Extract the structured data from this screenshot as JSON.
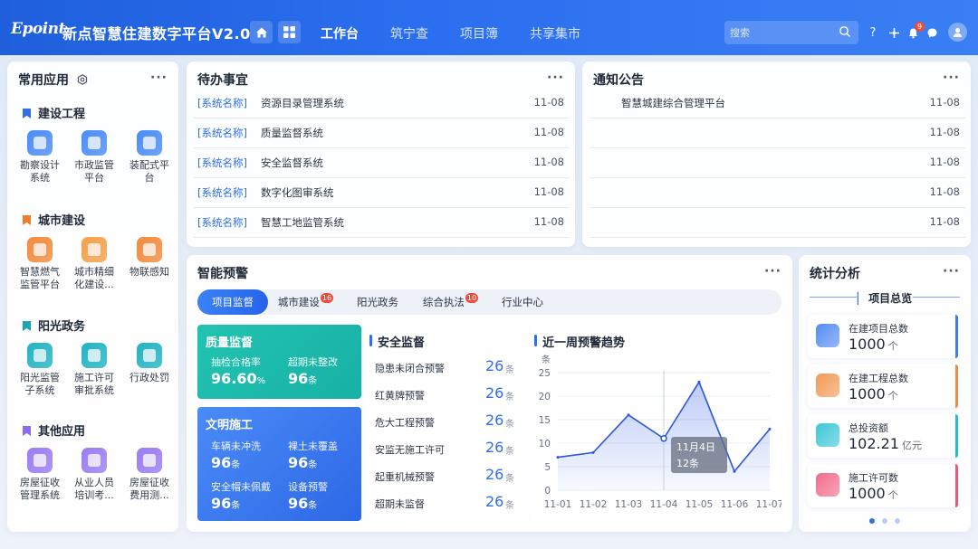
{
  "header": {
    "logo": "Epoint",
    "title": "新点智慧住建数字平台V2.0",
    "nav": [
      "工作台",
      "筑宁查",
      "项目簿",
      "共享集市"
    ],
    "search_placeholder": "搜索",
    "notification_count": "9"
  },
  "apps": {
    "title": "常用应用",
    "groups": [
      {
        "name": "建设工程",
        "color": "#2e6ee6",
        "items": [
          {
            "line1": "勘察设计",
            "line2": "系统",
            "icon": "survey-design-icon",
            "color": "#4a8cf7"
          },
          {
            "line1": "市政监管",
            "line2": "平台",
            "icon": "star-shield-icon",
            "color": "#4a8cf7"
          },
          {
            "line1": "装配式平",
            "line2": "台",
            "icon": "bookmark-icon",
            "color": "#4a8cf7"
          }
        ]
      },
      {
        "name": "城市建设",
        "color": "#f07d2e",
        "items": [
          {
            "line1": "智慧燃气",
            "line2": "监管平台",
            "icon": "flame-icon",
            "color": "#f38a3c"
          },
          {
            "line1": "城市精细",
            "line2": "化建设...",
            "icon": "building-icon",
            "color": "#f3a04a"
          },
          {
            "line1": "物联感知",
            "line2": "",
            "icon": "cube-icon",
            "color": "#f38a3c"
          }
        ]
      },
      {
        "name": "阳光政务",
        "color": "#18a6b8",
        "items": [
          {
            "line1": "阳光监管",
            "line2": "子系统",
            "icon": "shield-icon",
            "color": "#22b3c4"
          },
          {
            "line1": "施工许可",
            "line2": "审批系统",
            "icon": "monitor-icon",
            "color": "#22b3c4"
          },
          {
            "line1": "行政处罚",
            "line2": "",
            "icon": "penalty-shield-icon",
            "color": "#22b3c4"
          }
        ]
      },
      {
        "name": "其他应用",
        "color": "#8b6cf0",
        "items": [
          {
            "line1": "房屋征收",
            "line2": "管理系统",
            "icon": "house-icon",
            "color": "#9a7cf3"
          },
          {
            "line1": "从业人员",
            "line2": "培训考...",
            "icon": "briefcase-icon",
            "color": "#9a7cf3"
          },
          {
            "line1": "房屋征收",
            "line2": "费用测...",
            "icon": "document-icon",
            "color": "#9a7cf3"
          }
        ]
      }
    ]
  },
  "todo": {
    "title": "待办事宜",
    "items": [
      {
        "tag": "[系统名称]",
        "name": "资源目录管理系统",
        "date": "11-08"
      },
      {
        "tag": "[系统名称]",
        "name": "质量监督系统",
        "date": "11-08"
      },
      {
        "tag": "[系统名称]",
        "name": "安全监督系统",
        "date": "11-08"
      },
      {
        "tag": "[系统名称]",
        "name": "数字化图审系统",
        "date": "11-08"
      },
      {
        "tag": "[系统名称]",
        "name": "智慧工地监管系统",
        "date": "11-08"
      }
    ]
  },
  "notice": {
    "title": "通知公告",
    "items": [
      {
        "name": "智慧城建综合管理平台",
        "date": "11-08"
      },
      {
        "name": "",
        "date": "11-08"
      },
      {
        "name": "",
        "date": "11-08"
      },
      {
        "name": "",
        "date": "11-08"
      },
      {
        "name": "",
        "date": "11-08"
      }
    ]
  },
  "warning": {
    "title": "智能预警",
    "tabs": [
      {
        "label": "项目监督",
        "badge": ""
      },
      {
        "label": "城市建设",
        "badge": "16"
      },
      {
        "label": "阳光政务",
        "badge": ""
      },
      {
        "label": "综合执法",
        "badge": "10"
      },
      {
        "label": "行业中心",
        "badge": ""
      }
    ],
    "quality": {
      "title": "质量监督",
      "k1": "抽检合格率",
      "v1": "96.60",
      "u1": "%",
      "k2": "超期未整改",
      "v2": "96",
      "u2": "条",
      "color": "#1fbfae"
    },
    "civil": {
      "title": "文明施工",
      "k1": "车辆未冲洗",
      "v1": "96",
      "u1": "条",
      "k2": "裸土未覆盖",
      "v2": "96",
      "u2": "条",
      "k3": "安全帽未佩戴",
      "v3": "96",
      "u3": "条",
      "k4": "设备预警",
      "v4": "96",
      "u4": "条",
      "color": "#3a7bf0"
    },
    "safety": {
      "title": "安全监督",
      "rows": [
        {
          "k": "隐患未闭合预警",
          "v": "26",
          "u": "条"
        },
        {
          "k": "红黄牌预警",
          "v": "26",
          "u": "条"
        },
        {
          "k": "危大工程预警",
          "v": "26",
          "u": "条"
        },
        {
          "k": "安监无施工许可",
          "v": "26",
          "u": "条"
        },
        {
          "k": "起重机械预警",
          "v": "26",
          "u": "条"
        },
        {
          "k": "超期未监督",
          "v": "26",
          "u": "条"
        }
      ]
    }
  },
  "chart_data": {
    "type": "line",
    "title": "近一周预警趋势",
    "ylabel": "条",
    "categories": [
      "11-01",
      "11-02",
      "11-03",
      "11-04",
      "11-05",
      "11-06",
      "11-07"
    ],
    "series": [
      {
        "values": [
          7,
          8,
          16,
          11,
          23,
          4,
          13
        ]
      }
    ],
    "ylim": [
      0,
      25
    ],
    "yticks": [
      0,
      5,
      10,
      15,
      20,
      25
    ],
    "tooltip": {
      "label": "11月4日",
      "value": "12条"
    },
    "color": "#2f55d4",
    "grid": true
  },
  "stats": {
    "title": "统计分析",
    "subtitle": "项目总览",
    "items": [
      {
        "label": "在建项目总数",
        "value": "1000",
        "unit": "个",
        "color": "#3a7bf0",
        "icon": "project-icon"
      },
      {
        "label": "在建工程总数",
        "value": "1000",
        "unit": "个",
        "color": "#f08a3c",
        "icon": "engineering-icon"
      },
      {
        "label": "总投资额",
        "value": "102.21",
        "unit": "亿元",
        "color": "#1fbfd0",
        "icon": "wallet-icon"
      },
      {
        "label": "施工许可数",
        "value": "1000",
        "unit": "个",
        "color": "#f0557a",
        "icon": "permit-icon"
      }
    ]
  }
}
